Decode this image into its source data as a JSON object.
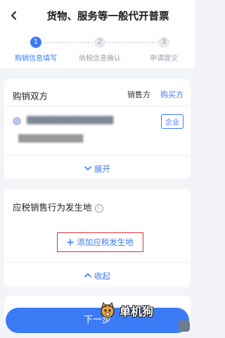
{
  "header": {
    "title": "货物、服务等一般代开普票",
    "back_icon": "chevron-left-icon"
  },
  "steps": [
    {
      "number": "1",
      "label": "购销信息填写",
      "active": true
    },
    {
      "number": "2",
      "label": "纳税信息确认",
      "active": false
    },
    {
      "number": "3",
      "label": "申请提交",
      "active": false
    }
  ],
  "parties": {
    "title": "购销双方",
    "seller_tab": "销售方",
    "buyer_tab": "购买方",
    "company_tag": "企业",
    "expand_label": "展开"
  },
  "location": {
    "title": "应税销售行为发生地",
    "add_label": "添加应税发生地",
    "collapse_label": "收起"
  },
  "footer": {
    "next_label": "下一步"
  },
  "watermark": {
    "text": "单机狗"
  },
  "colors": {
    "accent": "#3b7cf6",
    "highlight_border": "#e0303a",
    "background": "#f2f4f7"
  }
}
